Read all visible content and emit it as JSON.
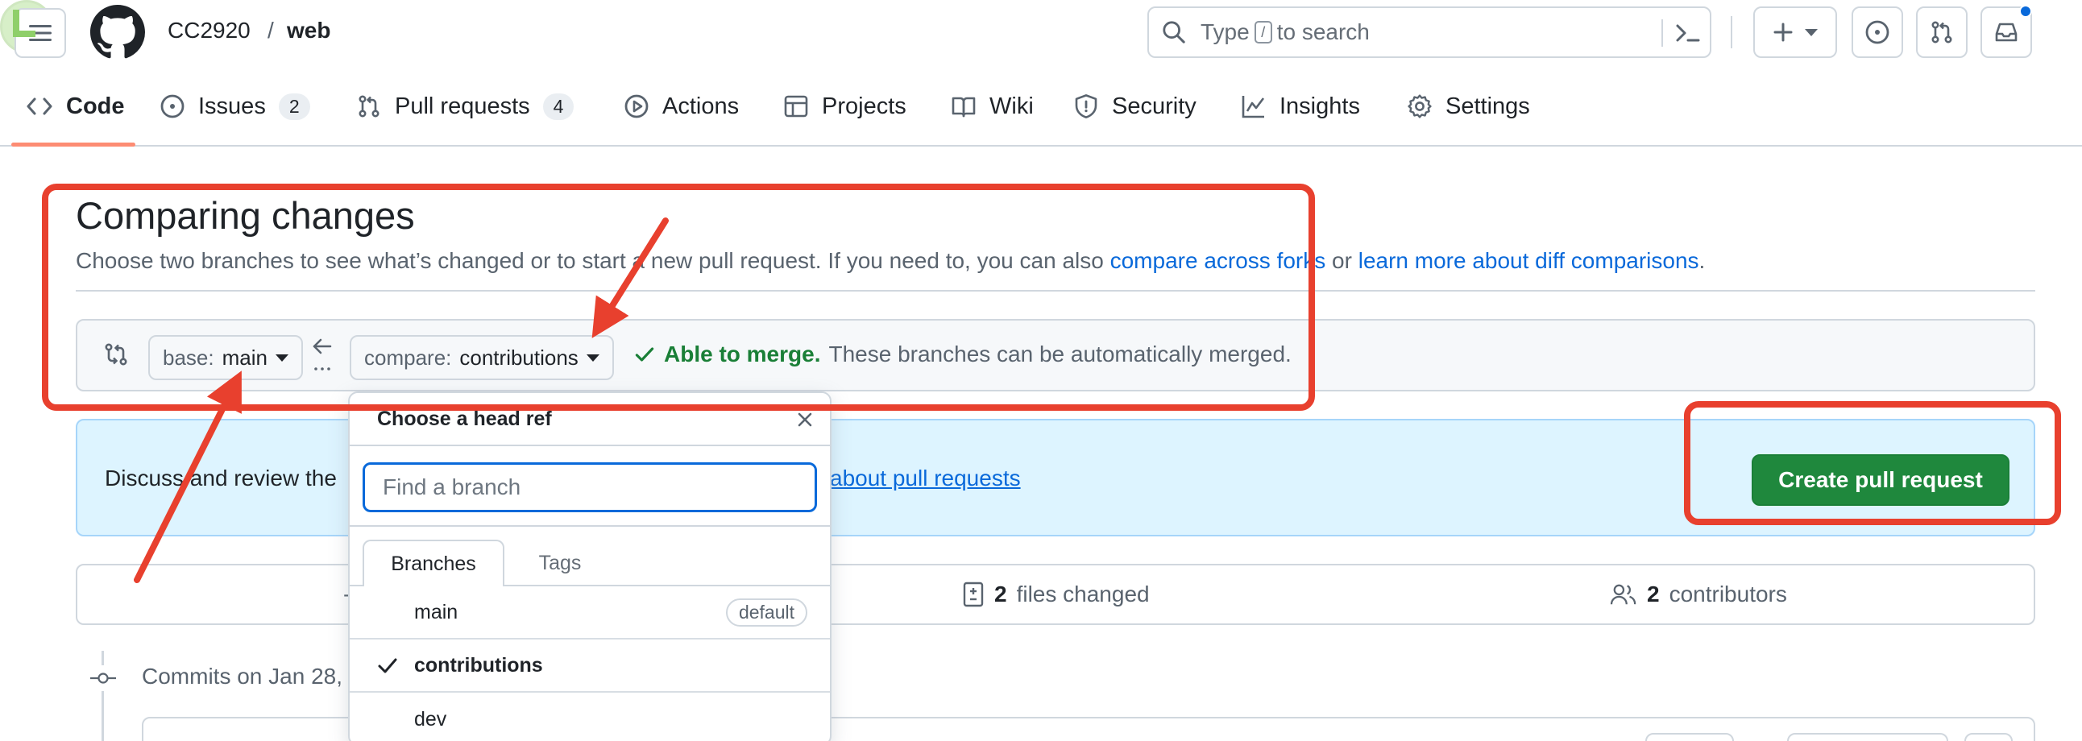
{
  "header": {
    "owner": "CC2920",
    "separator": "/",
    "repo": "web",
    "search": {
      "prefix": "Type",
      "key": "/",
      "suffix": "to search"
    }
  },
  "repo_nav": {
    "tabs": [
      {
        "label": "Code",
        "icon": "code-icon",
        "active": true
      },
      {
        "label": "Issues",
        "icon": "issue-opened-icon",
        "count": "2"
      },
      {
        "label": "Pull requests",
        "icon": "git-pull-request-icon",
        "count": "4"
      },
      {
        "label": "Actions",
        "icon": "play-icon"
      },
      {
        "label": "Projects",
        "icon": "table-icon"
      },
      {
        "label": "Wiki",
        "icon": "book-icon"
      },
      {
        "label": "Security",
        "icon": "shield-icon"
      },
      {
        "label": "Insights",
        "icon": "graph-icon"
      },
      {
        "label": "Settings",
        "icon": "gear-icon"
      }
    ]
  },
  "compare": {
    "title": "Comparing changes",
    "description": "Choose two branches to see what’s changed or to start a new pull request. If you need to, you can also",
    "link1": "compare across forks",
    "or": "or",
    "link2": "learn more about diff comparisons",
    "period": ".",
    "base_prefix": "base:",
    "base_branch": "main",
    "compare_prefix": "compare:",
    "compare_branch": "contributions",
    "merge_ok": "Able to merge.",
    "merge_text": "These branches can be automatically merged."
  },
  "flash": {
    "text": "Discuss and review the",
    "link": "about pull requests",
    "button": "Create pull request"
  },
  "stats": {
    "files_count": "2",
    "files_label": "files changed",
    "contributors_count": "2",
    "contributors_label": "contributors",
    "first_stub": "-"
  },
  "commits": {
    "date_label": "Commits on Jan 28,"
  },
  "dropdown": {
    "title": "Choose a head ref",
    "filter_placeholder": "Find a branch",
    "tabs": [
      "Branches",
      "Tags"
    ],
    "branches": [
      {
        "name": "main",
        "badge": "default",
        "selected": false
      },
      {
        "name": "contributions",
        "selected": true
      },
      {
        "name": "dev",
        "selected": false
      }
    ]
  },
  "colors": {
    "accent": "#0969da",
    "success": "#1f883d",
    "annotation": "#e8402e",
    "tab_underline": "#fd8c73"
  }
}
